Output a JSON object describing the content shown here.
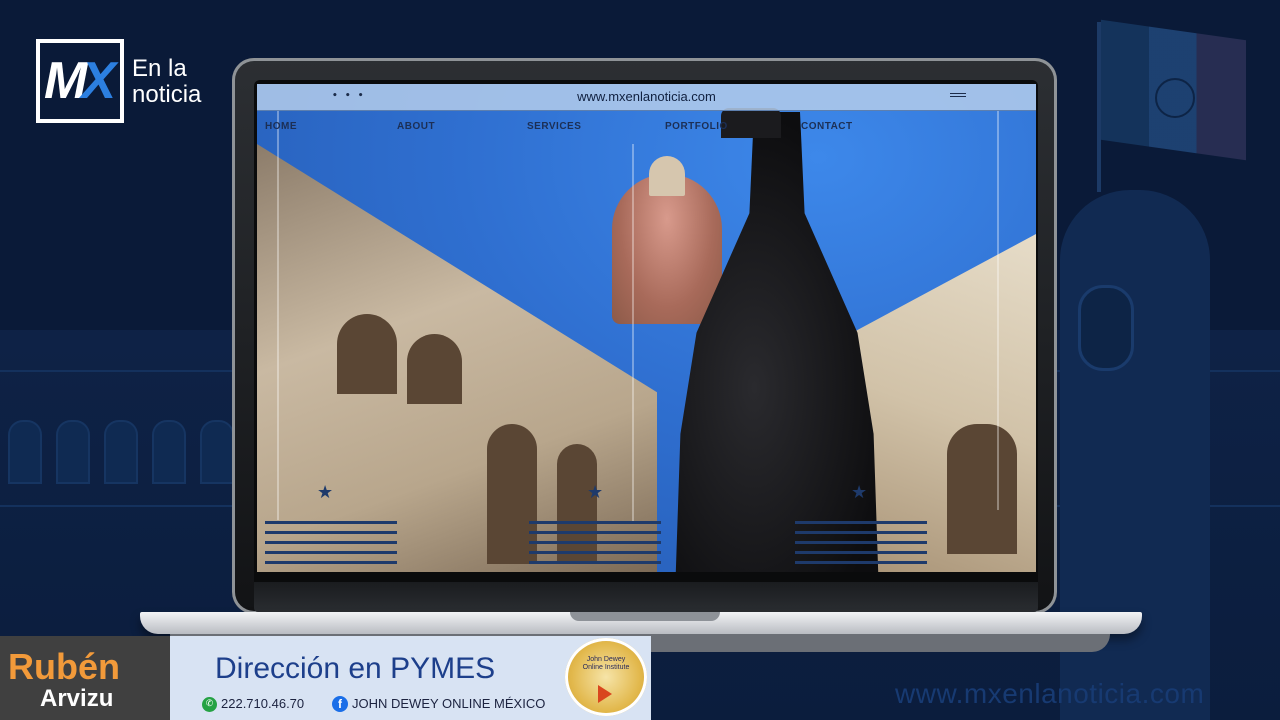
{
  "logo": {
    "mark_left": "M",
    "mark_right": "X",
    "tagline_line1": "En la",
    "tagline_line2": "noticia"
  },
  "browser": {
    "url": "www.mxenlanoticia.com",
    "window_dots": "• • •",
    "menu_icon": "hamburger-icon"
  },
  "website_nav": [
    {
      "label": "HOME"
    },
    {
      "label": "ABOUT"
    },
    {
      "label": "SERVICES"
    },
    {
      "label": "PORTFOLIO"
    },
    {
      "label": "CONTACT"
    }
  ],
  "banner": {
    "name_first": "Rubén",
    "name_last": "Arvizu",
    "title": "Dirección en PYMES",
    "phone": "222.710.46.70",
    "facebook": "JOHN DEWEY ONLINE MÉXICO",
    "seal_text": "John Dewey Online Institute"
  },
  "footer_url": "www.mxenlanoticia.com",
  "colors": {
    "background": "#0a1a38",
    "accent_blue": "#2c7fe0",
    "name_orange": "#f29a3a",
    "banner_light": "#d8e3f3"
  }
}
